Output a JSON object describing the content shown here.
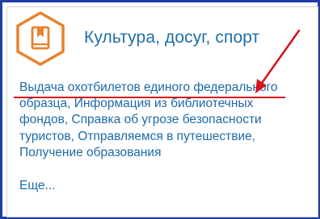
{
  "card": {
    "title": "Культура, досуг, спорт",
    "icon": "book-icon",
    "links": [
      "Выдача охотбилетов единого федерального образца",
      "Информация из библиотечных фондов",
      "Справка об угрозе безопасности туристов",
      "Отправляемся в путешествие",
      "Получение образования"
    ],
    "more_label": "Еще..."
  },
  "colors": {
    "accent": "#e8812c",
    "link": "#1c6aa6",
    "title": "#1f6fa8",
    "annotation": "#d4131b",
    "frame": "#1d3fa8"
  }
}
